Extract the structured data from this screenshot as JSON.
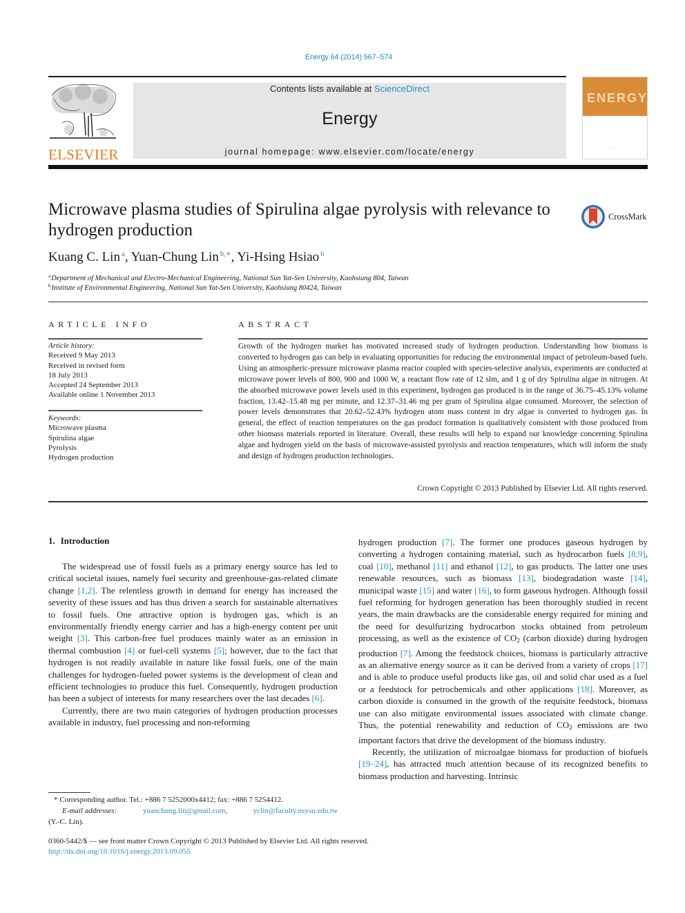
{
  "journal_ref": "Energy 64 (2014) 567–574",
  "header": {
    "contents_prefix": "Contents lists available at ",
    "contents_link": "ScienceDirect",
    "journal_name": "Energy",
    "homepage_label": "journal homepage: www.elsevier.com/locate/energy",
    "publisher_logo_text": "ELSEVIER",
    "cover_title": "ENERGY",
    "crossmark_label": "CrossMark"
  },
  "colors": {
    "link": "#2a8ec8",
    "elsevier_orange": "#e8781e",
    "banner_bg": "#e6e6e6",
    "cover_orange": "#d98c38"
  },
  "article": {
    "title": "Microwave plasma studies of Spirulina algae pyrolysis with relevance to hydrogen production",
    "authors": [
      {
        "name": "Kuang C. Lin",
        "sup": "a"
      },
      {
        "name": "Yuan-Chung Lin",
        "sup": "b,∗"
      },
      {
        "name": "Yi-Hsing Hsiao",
        "sup": "b"
      }
    ],
    "affiliations": [
      {
        "key": "a",
        "text": "Department of Mechanical and Electro-Mechanical Engineering, National Sun Yat-Sen University, Kaohsiung 804, Taiwan"
      },
      {
        "key": "b",
        "text": "Institute of Environmental Engineering, National Sun Yat-Sen University, Kaohsiung 80424, Taiwan"
      }
    ]
  },
  "article_info": {
    "heading": "ARTICLE INFO",
    "history_label": "Article history:",
    "history": [
      "Received 9 May 2013",
      "Received in revised form",
      "18 July 2013",
      "Accepted 24 September 2013",
      "Available online 1 November 2013"
    ],
    "keywords_label": "Keywords:",
    "keywords": [
      "Microwave plasma",
      "Spirulina algae",
      "Pyrolysis",
      "Hydrogen production"
    ]
  },
  "abstract": {
    "heading": "ABSTRACT",
    "text": "Growth of the hydrogen market has motivated increased study of hydrogen production. Understanding how biomass is converted to hydrogen gas can help in evaluating opportunities for reducing the environmental impact of petroleum-based fuels. Using an atmospheric-pressure microwave plasma reactor coupled with species-selective analysis, experiments are conducted at microwave power levels of 800, 900 and 1000 W, a reactant flow rate of 12 slm, and 1 g of dry Spirulina algae in nitrogen. At the absorbed microwave power levels used in this experiment, hydrogen gas produced is in the range of 36.75–45.13% volume fraction, 13.42–15.48 mg per minute, and 12.37–31.46 mg per gram of Spirulina algae consumed. Moreover, the selection of power levels demonstrates that 20.62–52.43% hydrogen atom mass content in dry algae is converted to hydrogen gas. In general, the effect of reaction temperatures on the gas product formation is qualitatively consistent with those produced from other biomass materials reported in literature. Overall, these results will help to expand our knowledge concerning Spirulina algae and hydrogen yield on the basis of microwave-assisted pyrolysis and reaction temperatures, which will inform the study and design of hydrogen production technologies.",
    "copyright": "Crown Copyright © 2013 Published by Elsevier Ltd. All rights reserved."
  },
  "introduction": {
    "number": "1.",
    "title": "Introduction",
    "left_column": [
      {
        "segments": [
          {
            "t": "The widespread use of fossil fuels as a primary energy source has led to critical societal issues, namely fuel security and greenhouse-gas-related climate change "
          },
          {
            "c": "[1,2]"
          },
          {
            "t": ". The relentless growth in demand for energy has increased the severity of these issues and has thus driven a search for sustainable alternatives to fossil fuels. One attractive option is hydrogen gas, which is an environmentally friendly energy carrier and has a high-energy content per unit weight "
          },
          {
            "c": "[3]"
          },
          {
            "t": ". This carbon-free fuel produces mainly water as an emission in thermal combustion "
          },
          {
            "c": "[4]"
          },
          {
            "t": " or fuel-cell systems "
          },
          {
            "c": "[5]"
          },
          {
            "t": "; however, due to the fact that hydrogen is not readily available in nature like fossil fuels, one of the main challenges for hydrogen-fueled power systems is the development of clean and efficient technologies to produce this fuel. Consequently, hydrogen production has been a subject of interests for many researchers over the last decades "
          },
          {
            "c": "[6]"
          },
          {
            "t": "."
          }
        ]
      },
      {
        "segments": [
          {
            "t": "Currently, there are two main categories of hydrogen production processes available in industry, fuel processing and non-reforming"
          }
        ]
      }
    ],
    "right_column": [
      {
        "indent": false,
        "segments": [
          {
            "t": "hydrogen production "
          },
          {
            "c": "[7]"
          },
          {
            "t": ". The former one produces gaseous hydrogen by converting a hydrogen containing material, such as hydrocarbon fuels "
          },
          {
            "c": "[8,9]"
          },
          {
            "t": ", coal "
          },
          {
            "c": "[10]"
          },
          {
            "t": ", methanol "
          },
          {
            "c": "[11]"
          },
          {
            "t": " and ethanol "
          },
          {
            "c": "[12]"
          },
          {
            "t": ", to gas products. The latter one uses renewable resources, such as biomass "
          },
          {
            "c": "[13]"
          },
          {
            "t": ", biodegradation waste "
          },
          {
            "c": "[14]"
          },
          {
            "t": ", municipal waste "
          },
          {
            "c": "[15]"
          },
          {
            "t": " and water "
          },
          {
            "c": "[16]"
          },
          {
            "t": ", to form gaseous hydrogen. Although fossil fuel reforming for hydrogen generation has been thoroughly studied in recent years, the main drawbacks are the considerable energy required for mining and the need for desulfurizing hydrocarbon stocks obtained from petroleum processing, as well as the existence of CO"
          },
          {
            "sub": "2"
          },
          {
            "t": " (carbon dioxide) during hydrogen production "
          },
          {
            "c": "[7]"
          },
          {
            "t": ". Among the feedstock choices, biomass is particularly attractive as an alternative energy source as it can be derived from a variety of crops "
          },
          {
            "c": "[17]"
          },
          {
            "t": " and is able to produce useful products like gas, oil and solid char used as a fuel or a feedstock for petrochemicals and other applications "
          },
          {
            "c": "[18]"
          },
          {
            "t": ". Moreover, as carbon dioxide is consumed in the growth of the requisite feedstock, biomass use can also mitigate environmental issues associated with climate change. Thus, the potential renewability and reduction of CO"
          },
          {
            "sub": "2"
          },
          {
            "t": " emissions are two important factors that drive the development of the biomass industry."
          }
        ]
      },
      {
        "indent": true,
        "segments": [
          {
            "t": "Recently, the utilization of microalgae biomass for production of biofuels "
          },
          {
            "c": "[19–24]"
          },
          {
            "t": ", has attracted much attention because of its recognized benefits to biomass production and harvesting. Intrinsic"
          }
        ]
      }
    ]
  },
  "footnote": {
    "marker": "*",
    "corresponding": "Corresponding author. Tel.: +886 7 5252000x4412; fax: +886 7 5254412.",
    "email_label": "E-mail addresses:",
    "emails": [
      "yuanchung.lin@gmail.com,",
      "yclin@faculty.nsysu.edu.tw"
    ],
    "email_owner": "(Y.-C. Lin)."
  },
  "front_matter": {
    "issn_line": "0360-5442/$ — see front matter Crown Copyright © 2013 Published by Elsevier Ltd. All rights reserved.",
    "doi": "http://dx.doi.org/10.1016/j.energy.2013.09.055"
  }
}
